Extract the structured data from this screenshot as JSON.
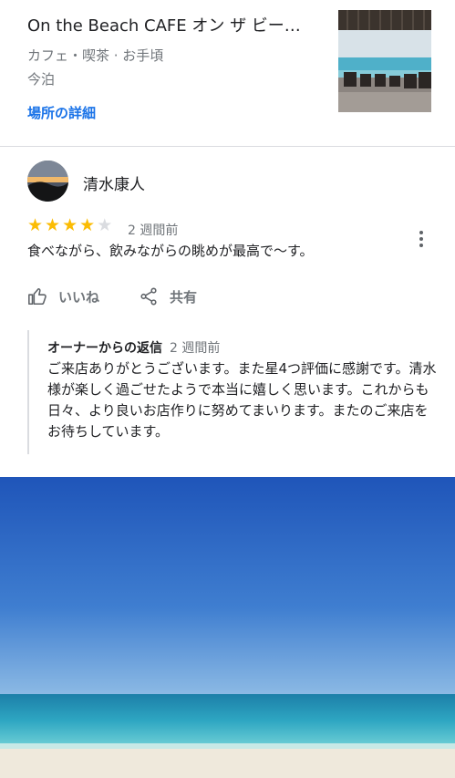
{
  "place": {
    "name": "On the Beach CAFE オン ザ ビー…",
    "category": "カフェ・喫茶 · お手頃",
    "location": "今泊",
    "details_link": "場所の詳細"
  },
  "review": {
    "author": "清水康人",
    "rating": 4,
    "rating_max": 5,
    "date": "2 週間前",
    "text": "食べながら、飲みながらの眺めが最高で〜す。",
    "like_label": "いいね",
    "share_label": "共有"
  },
  "owner_reply": {
    "title": "オーナーからの返信",
    "date": "2 週間前",
    "text": "ご来店ありがとうございます。また星4つ評価に感謝です。清水様が楽しく過ごせたようで本当に嬉しく思います。これからも日々、より良いお店作りに努めてまいります。またのご来店をお待ちしています。"
  },
  "colors": {
    "link": "#1a73e8",
    "star_filled": "#fbbc04",
    "star_empty": "#dadce0",
    "secondary_text": "#70757a"
  }
}
